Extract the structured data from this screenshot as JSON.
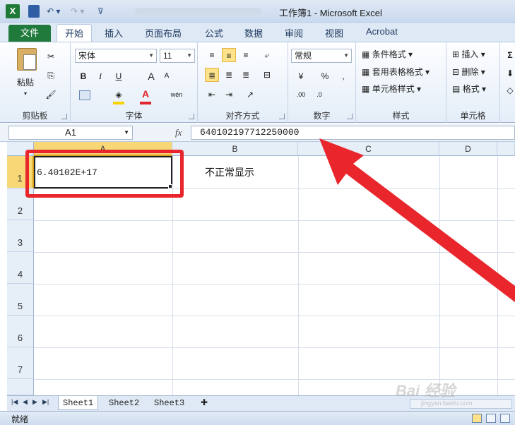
{
  "window": {
    "title": "工作簿1 - Microsoft Excel",
    "app_icon": "X"
  },
  "ribbon_tabs": {
    "file": "文件",
    "items": [
      "开始",
      "插入",
      "页面布局",
      "公式",
      "数据",
      "审阅",
      "视图",
      "Acrobat"
    ],
    "active": "开始"
  },
  "clipboard": {
    "paste": "粘贴",
    "label": "剪贴板"
  },
  "font": {
    "name": "宋体",
    "size": "11",
    "bold": "B",
    "italic": "I",
    "underline": "U",
    "grow": "A",
    "shrink": "A",
    "color": "A",
    "phonetic": "wén",
    "label": "字体",
    "font_color_hex": "#e0262c",
    "fill_color_hex": "#f6d400"
  },
  "alignment": {
    "label": "对齐方式"
  },
  "number": {
    "format": "常规",
    "percent": "%",
    "comma": ",",
    "label": "数字"
  },
  "styles": {
    "conditional": "条件格式",
    "table": "套用表格格式",
    "cell": "单元格样式",
    "label": "样式"
  },
  "cells": {
    "insert": "插入",
    "delete": "删除",
    "format": "格式",
    "label": "单元格"
  },
  "editing": {
    "sum": "Σ"
  },
  "formula_bar": {
    "name_box": "A1",
    "fx": "fx",
    "value": "640102197712250000"
  },
  "grid": {
    "columns": [
      "A",
      "B",
      "C",
      "D"
    ],
    "rows": [
      "1",
      "2",
      "3",
      "4",
      "5",
      "6",
      "7"
    ],
    "a1": "6.40102E+17",
    "b1": "不正常显示"
  },
  "sheets": {
    "tabs": [
      "Sheet1",
      "Sheet2",
      "Sheet3"
    ],
    "active": "Sheet1"
  },
  "status": {
    "text": "就绪"
  },
  "annotation": {
    "highlight_color": "#e8262c"
  },
  "watermark": {
    "main": "Bai 经验",
    "sub": "jingyan.baidu.com"
  }
}
